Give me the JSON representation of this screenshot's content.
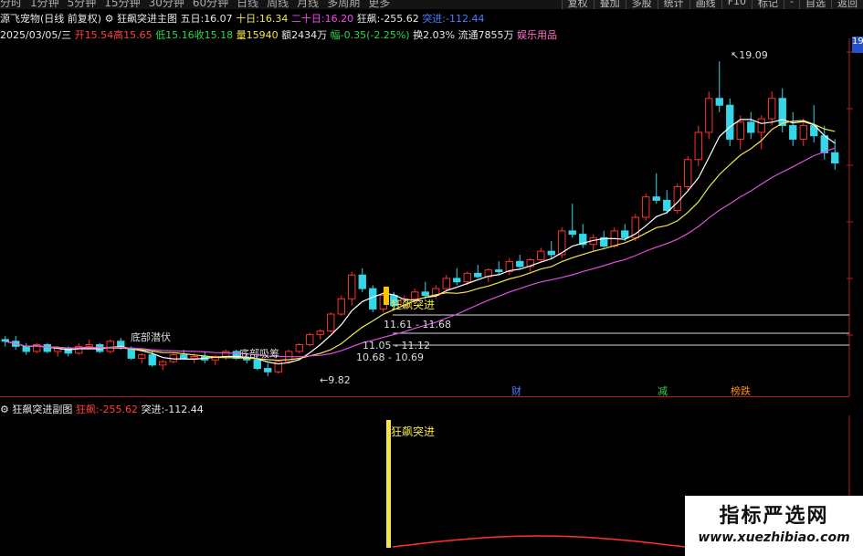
{
  "toolbar": {
    "periods": [
      "分时",
      "1分钟",
      "5分钟",
      "15分钟",
      "30分钟",
      "60分钟",
      "日线",
      "周线",
      "月线",
      "多周期",
      "更多"
    ],
    "right_buttons": [
      "复权",
      "叠加",
      "多股",
      "统计",
      "画线",
      "F10",
      "标记",
      "-",
      "自选",
      "返回"
    ]
  },
  "header1": {
    "stock": "源飞宠物(日线 前复权)",
    "indicator": "狂飙突进主图",
    "ma5_label": "五日:",
    "ma5": "16.07",
    "ma10_label": "十日:",
    "ma10": "16.34",
    "ma20_label": "二十日:",
    "ma20": "16.20",
    "kb_label": "狂飙:",
    "kb": "-255.62",
    "tj_label": "突进:",
    "tj": "-112.44"
  },
  "header2": {
    "date": "2025/03/05/三",
    "open_label": "开",
    "open": "15.54",
    "high_label": "高",
    "high": "15.65",
    "low_label": "低",
    "low": "15.16",
    "close_label": "收",
    "close": "15.18",
    "vol_label": "量",
    "vol": "15940",
    "amt_label": "额",
    "amt": "2434万",
    "chg_label": "幅",
    "chg": "-0.35(-2.25%)",
    "turn_label": "换",
    "turn": "2.03%",
    "float_label": "流通",
    "float": "7855万",
    "industry": "娱乐用品"
  },
  "annotations": {
    "high_price": "19.09",
    "low_price": "9.82",
    "signal": "狂飙突进",
    "range1": "11.61 - 11.68",
    "range2": "11.05 - 11.12",
    "range3": "10.68 - 10.69",
    "label_left1": "底部潜伏",
    "label_left2": "底部吸筹",
    "tag_cai": "财",
    "tag_jian": "减",
    "tag_bang": "榜跌",
    "price_tag": "19"
  },
  "sub_header": {
    "name": "狂飙突进副图",
    "kb_label": "狂飙:",
    "kb": "-255.62",
    "tj_label": "突进:",
    "tj": "-112.44",
    "signal": "狂飙突进"
  },
  "watermark": {
    "title": "指标严选网",
    "url": "www.xuezhibiao.com"
  },
  "colors": {
    "up": "#ff3030",
    "down": "#35d6e8",
    "ma5": "#ffffff",
    "ma10": "#f2e64a",
    "ma20": "#e050e0",
    "signal": "#f2e64a"
  },
  "chart_data": {
    "type": "candlestick",
    "price_range": [
      9.5,
      19.5
    ],
    "candles": [
      [
        10.9,
        11.0,
        10.7,
        10.85
      ],
      [
        10.85,
        11.0,
        10.6,
        10.7
      ],
      [
        10.7,
        10.8,
        10.45,
        10.55
      ],
      [
        10.55,
        10.8,
        10.5,
        10.75
      ],
      [
        10.75,
        10.8,
        10.5,
        10.55
      ],
      [
        10.55,
        10.7,
        10.4,
        10.65
      ],
      [
        10.65,
        10.7,
        10.4,
        10.5
      ],
      [
        10.5,
        10.8,
        10.45,
        10.7
      ],
      [
        10.7,
        10.9,
        10.6,
        10.75
      ],
      [
        10.75,
        10.8,
        10.5,
        10.55
      ],
      [
        10.55,
        10.9,
        10.5,
        10.85
      ],
      [
        10.85,
        10.95,
        10.6,
        10.65
      ],
      [
        10.65,
        10.7,
        10.3,
        10.35
      ],
      [
        10.35,
        10.5,
        10.2,
        10.45
      ],
      [
        10.45,
        10.55,
        10.1,
        10.15
      ],
      [
        10.15,
        10.3,
        10.0,
        10.25
      ],
      [
        10.25,
        10.5,
        10.2,
        10.45
      ],
      [
        10.45,
        10.6,
        10.3,
        10.35
      ],
      [
        10.35,
        10.5,
        10.2,
        10.4
      ],
      [
        10.4,
        10.55,
        10.2,
        10.3
      ],
      [
        10.3,
        10.45,
        10.15,
        10.4
      ],
      [
        10.4,
        10.6,
        10.3,
        10.55
      ],
      [
        10.55,
        10.6,
        10.3,
        10.35
      ],
      [
        10.35,
        10.5,
        10.2,
        10.3
      ],
      [
        10.3,
        10.4,
        10.0,
        10.05
      ],
      [
        10.05,
        10.2,
        9.82,
        9.95
      ],
      [
        9.95,
        10.3,
        9.9,
        10.25
      ],
      [
        10.25,
        10.6,
        10.2,
        10.55
      ],
      [
        10.55,
        10.8,
        10.5,
        10.75
      ],
      [
        10.75,
        11.1,
        10.7,
        11.05
      ],
      [
        11.05,
        11.2,
        10.9,
        11.15
      ],
      [
        11.15,
        11.7,
        11.1,
        11.65
      ],
      [
        11.65,
        12.2,
        11.6,
        12.1
      ],
      [
        12.1,
        12.9,
        11.9,
        12.8
      ],
      [
        12.8,
        13.0,
        12.3,
        12.4
      ],
      [
        12.4,
        12.5,
        11.7,
        11.8
      ],
      [
        11.8,
        12.3,
        11.7,
        12.2
      ],
      [
        12.2,
        12.3,
        11.8,
        11.9
      ],
      [
        11.9,
        12.2,
        11.8,
        12.1
      ],
      [
        12.1,
        12.4,
        12.0,
        12.3
      ],
      [
        12.3,
        12.6,
        12.1,
        12.2
      ],
      [
        12.2,
        12.5,
        12.1,
        12.4
      ],
      [
        12.4,
        12.8,
        12.3,
        12.7
      ],
      [
        12.7,
        13.0,
        12.5,
        12.6
      ],
      [
        12.6,
        12.9,
        12.5,
        12.85
      ],
      [
        12.85,
        13.1,
        12.7,
        12.75
      ],
      [
        12.75,
        13.0,
        12.6,
        12.95
      ],
      [
        12.95,
        13.2,
        12.8,
        12.9
      ],
      [
        12.9,
        13.3,
        12.8,
        13.2
      ],
      [
        13.2,
        13.4,
        13.0,
        13.05
      ],
      [
        13.05,
        13.3,
        12.9,
        13.25
      ],
      [
        13.25,
        13.6,
        13.2,
        13.5
      ],
      [
        13.5,
        13.8,
        13.3,
        13.4
      ],
      [
        13.4,
        14.2,
        13.3,
        14.1
      ],
      [
        14.1,
        14.9,
        13.9,
        14.0
      ],
      [
        14.0,
        14.3,
        13.6,
        13.7
      ],
      [
        13.7,
        14.0,
        13.5,
        13.9
      ],
      [
        13.9,
        14.1,
        13.6,
        13.65
      ],
      [
        13.65,
        14.2,
        13.6,
        14.1
      ],
      [
        14.1,
        14.3,
        13.8,
        13.9
      ],
      [
        13.9,
        14.6,
        13.8,
        14.5
      ],
      [
        14.5,
        15.2,
        14.4,
        15.1
      ],
      [
        15.1,
        15.8,
        14.9,
        15.0
      ],
      [
        15.0,
        15.3,
        14.6,
        14.7
      ],
      [
        14.7,
        15.5,
        14.6,
        15.4
      ],
      [
        15.4,
        16.3,
        15.3,
        16.2
      ],
      [
        16.2,
        17.2,
        16.0,
        17.0
      ],
      [
        17.0,
        18.2,
        16.8,
        18.0
      ],
      [
        18.0,
        19.09,
        17.6,
        17.8
      ],
      [
        17.8,
        18.0,
        16.6,
        16.8
      ],
      [
        16.8,
        17.5,
        16.5,
        17.3
      ],
      [
        17.3,
        17.6,
        16.8,
        17.0
      ],
      [
        17.0,
        17.5,
        16.5,
        17.4
      ],
      [
        17.4,
        18.2,
        17.2,
        18.0
      ],
      [
        18.0,
        18.3,
        17.0,
        17.2
      ],
      [
        17.2,
        17.6,
        16.6,
        16.8
      ],
      [
        16.8,
        17.4,
        16.6,
        17.2
      ],
      [
        17.2,
        17.8,
        16.7,
        16.9
      ],
      [
        16.9,
        17.2,
        16.2,
        16.4
      ],
      [
        16.4,
        16.8,
        15.9,
        16.1
      ]
    ]
  }
}
